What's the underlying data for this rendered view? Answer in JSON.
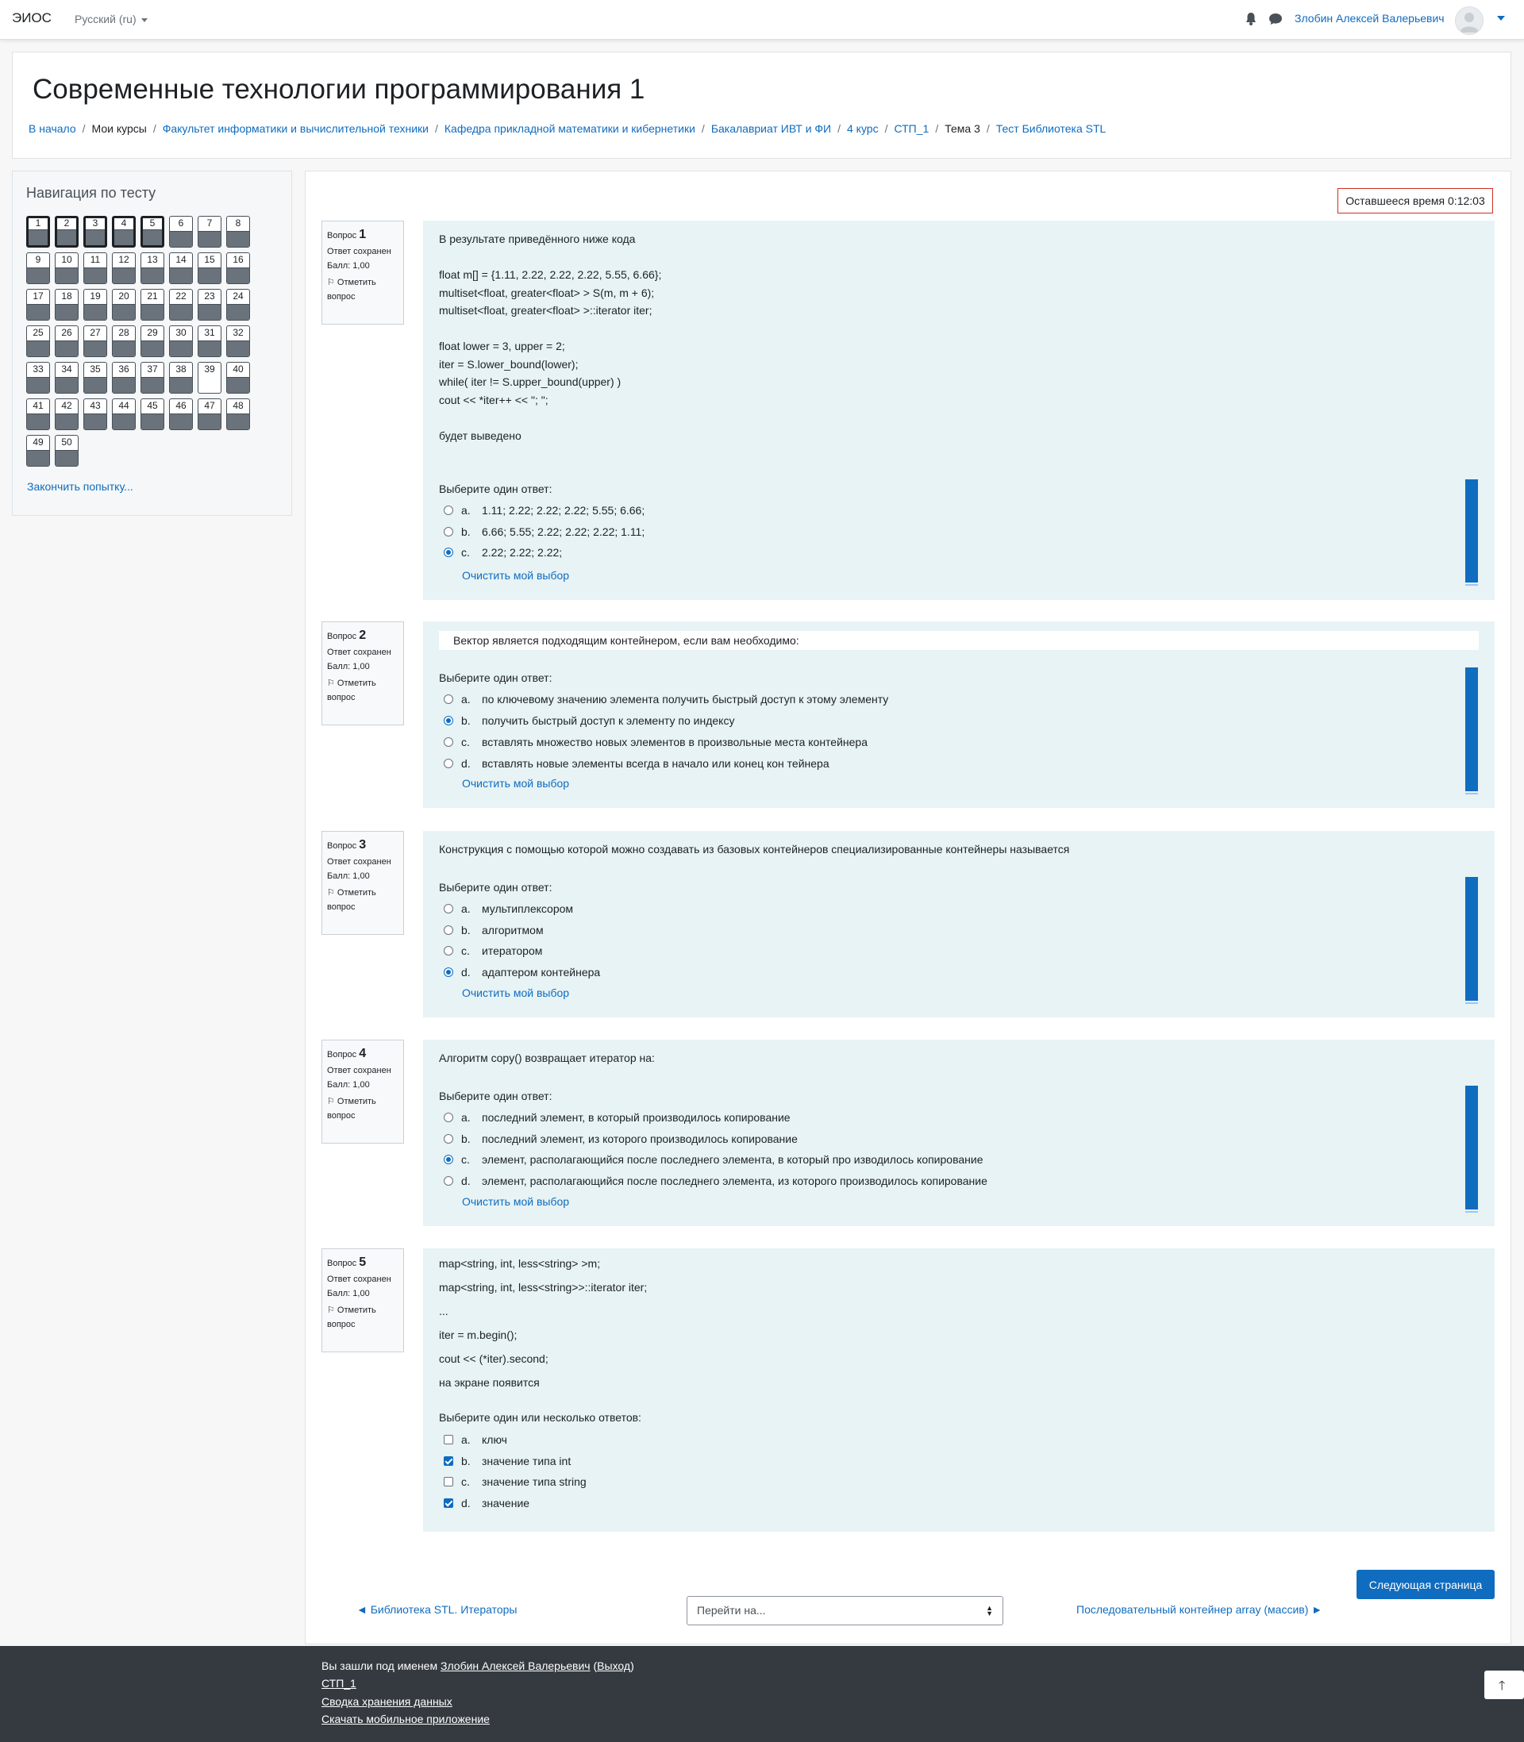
{
  "navbar": {
    "brand": "ЭИОС",
    "language": "Русский (ru)",
    "user_name": "Злобин Алексей Валерьевич"
  },
  "header": {
    "title": "Современные технологии программирования 1",
    "breadcrumb": [
      {
        "label": "В начало",
        "link": true
      },
      {
        "label": "Мои курсы",
        "link": false
      },
      {
        "label": "Факультет информатики и вычислительной техники",
        "link": true
      },
      {
        "label": "Кафедра прикладной математики и кибернетики",
        "link": true
      },
      {
        "label": "Бакалавриат ИВТ и ФИ",
        "link": true
      },
      {
        "label": "4 курс",
        "link": true
      },
      {
        "label": "СТП_1",
        "link": true
      },
      {
        "label": "Тема 3",
        "link": false
      },
      {
        "label": "Тест Библиотека STL",
        "link": true
      }
    ]
  },
  "quiz_nav": {
    "title": "Навигация по тесту",
    "numbers": [
      "1",
      "2",
      "3",
      "4",
      "5",
      "6",
      "7",
      "8",
      "9",
      "10",
      "11",
      "12",
      "13",
      "14",
      "15",
      "16",
      "17",
      "18",
      "19",
      "20",
      "21",
      "22",
      "23",
      "24",
      "25",
      "26",
      "27",
      "28",
      "29",
      "30",
      "31",
      "32",
      "33",
      "34",
      "35",
      "36",
      "37",
      "38",
      "39",
      "40",
      "41",
      "42",
      "43",
      "44",
      "45",
      "46",
      "47",
      "48",
      "49",
      "50"
    ],
    "current_page": [
      1,
      2,
      3,
      4,
      5
    ],
    "unanswered": [
      39
    ],
    "finish": "Закончить попытку..."
  },
  "timer": "Оставшееся время 0:12:03",
  "info_labels": {
    "question": "Вопрос",
    "status": "Ответ сохранен",
    "mark": "Балл: 1,00",
    "flag1": "Отметить",
    "flag2": "вопрос"
  },
  "questions": [
    {
      "number": "1",
      "text": "В результате приведённого ниже кода\n\nfloat m[] = {1.11, 2.22, 2.22, 2.22, 5.55, 6.66};\nmultiset<float, greater<float> > S(m, m + 6);\nmultiset<float, greater<float> >::iterator iter;\n\nfloat lower = 3, upper = 2;\niter = S.lower_bound(lower);\nwhile( iter != S.upper_bound(upper) )\ncout << *iter++ << \"; \";\n\nбудет выведено",
      "prompt": "Выберите один ответ:",
      "answers": [
        {
          "letter": "a.",
          "text": "1.11; 2.22; 2.22; 2.22; 5.55; 6.66;",
          "selected": false
        },
        {
          "letter": "b.",
          "text": "6.66; 5.55; 2.22; 2.22; 2.22; 1.11;",
          "selected": false
        },
        {
          "letter": "c.",
          "text": "2.22; 2.22; 2.22;",
          "selected": true
        }
      ],
      "clear": "Очистить мой выбор"
    },
    {
      "number": "2",
      "text": "Вектор является подходящим контейнером, если вам необходимо:",
      "prompt": "Выберите один ответ:",
      "answers": [
        {
          "letter": "a.",
          "text": "по ключевому значению элемента получить быстрый доступ к этому элементу",
          "selected": false
        },
        {
          "letter": "b.",
          "text": "получить быстрый доступ к элементу по индексу",
          "selected": true
        },
        {
          "letter": "c.",
          "text": "вставлять множество новых элементов в произвольные места контейнера",
          "selected": false
        },
        {
          "letter": "d.",
          "text": "вставлять новые элементы всегда в начало или конец кон тейнера",
          "selected": false
        }
      ],
      "clear": "Очистить мой выбор"
    },
    {
      "number": "3",
      "text": "Конструкция с помощью которой можно создавать из базовых контейнеров специализированные контейнеры называется",
      "prompt": "Выберите один ответ:",
      "answers": [
        {
          "letter": "a.",
          "text": "мультиплексором",
          "selected": false
        },
        {
          "letter": "b.",
          "text": "алгоритмом",
          "selected": false
        },
        {
          "letter": "c.",
          "text": "итератором",
          "selected": false
        },
        {
          "letter": "d.",
          "text": "адаптером контейнера",
          "selected": true
        }
      ],
      "clear": "Очистить мой выбор"
    },
    {
      "number": "4",
      "text": "Алгоритм copy() возвращает итератор на:",
      "prompt": "Выберите один ответ:",
      "answers": [
        {
          "letter": "a.",
          "text": "последний элемент, в который производилось копирование",
          "selected": false
        },
        {
          "letter": "b.",
          "text": "последний элемент, из которого производилось копирование",
          "selected": false
        },
        {
          "letter": "c.",
          "text": "элемент, располагающийся после последнего элемента, в который про изводилось копирование",
          "selected": true
        },
        {
          "letter": "d.",
          "text": "элемент, располагающийся после последнего элемента, из которого производилось копирование",
          "selected": false
        }
      ],
      "clear": "Очистить мой выбор"
    },
    {
      "number": "5",
      "lines": [
        "map<string, int, less<string> >m;",
        "map<string, int, less<string>>::iterator iter;",
        "...",
        "iter = m.begin();",
        "cout << (*iter).second;",
        "на экране появится"
      ],
      "prompt": "Выберите один или несколько ответов:",
      "answers": [
        {
          "letter": "a.",
          "text": "ключ",
          "selected": false
        },
        {
          "letter": "b.",
          "text": "значение типа int",
          "selected": true
        },
        {
          "letter": "c.",
          "text": "значение типа string",
          "selected": false
        },
        {
          "letter": "d.",
          "text": "значение",
          "selected": true
        }
      ]
    }
  ],
  "page_nav": {
    "next_button": "Следующая страница",
    "prev_link": "◄ Библиотека STL. Итераторы",
    "jump_placeholder": "Перейти на...",
    "next_link": "Последовательный контейнер array (массив) ►"
  },
  "footer": {
    "logged_in_prefix": "Вы зашли под именем ",
    "user": "Злобин Алексей Валерьевич",
    "logout": "Выход",
    "course": "СТП_1",
    "data_retention": "Сводка хранения данных",
    "mobile_app": "Скачать мобильное приложение"
  }
}
